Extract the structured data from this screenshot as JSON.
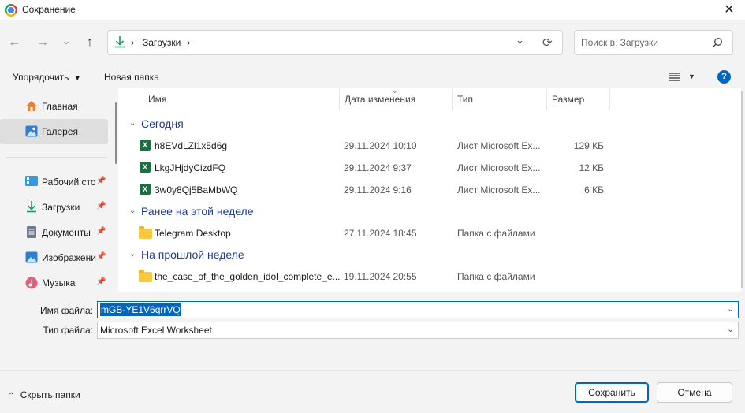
{
  "window": {
    "title": "Сохранение",
    "close_glyph": "✕"
  },
  "nav": {
    "back_glyph": "←",
    "forward_glyph": "→",
    "recent_glyph": "⌄",
    "up_glyph": "↑",
    "path_separator": "›",
    "path": "Загрузки",
    "path_trailing_sep": "›",
    "dropdown_glyph": "⌄",
    "refresh_glyph": "⟳",
    "search_placeholder": "Поиск в: Загрузки",
    "search_glyph": "⌕"
  },
  "toolbar": {
    "organize_label": "Упорядочить",
    "new_folder_label": "Новая папка",
    "help_glyph": "?"
  },
  "sidebar": {
    "items": [
      {
        "label": "Главная",
        "pinned": false,
        "icon": "home-icon"
      },
      {
        "label": "Галерея",
        "pinned": false,
        "icon": "gallery-icon",
        "selected": true
      },
      {
        "label": "Рабочий сто",
        "pinned": true,
        "icon": "desktop-icon"
      },
      {
        "label": "Загрузки",
        "pinned": true,
        "icon": "downloads-icon"
      },
      {
        "label": "Документы",
        "pinned": true,
        "icon": "documents-icon"
      },
      {
        "label": "Изображени",
        "pinned": true,
        "icon": "pictures-icon"
      },
      {
        "label": "Музыка",
        "pinned": true,
        "icon": "music-icon"
      }
    ],
    "pin_glyph": "📌"
  },
  "columns": {
    "name": "Имя",
    "date": "Дата изменения",
    "type": "Тип",
    "size": "Размер"
  },
  "groups": [
    {
      "label": "Сегодня",
      "rows": [
        {
          "name": "h8EVdLZl1x5d6g",
          "date": "29.11.2024 10:10",
          "type": "Лист Microsoft Ex...",
          "size": "129 КБ",
          "kind": "excel"
        },
        {
          "name": "LkgJHjdyCizdFQ",
          "date": "29.11.2024 9:37",
          "type": "Лист Microsoft Ex...",
          "size": "12 КБ",
          "kind": "excel"
        },
        {
          "name": "3w0y8Qj5BaMbWQ",
          "date": "29.11.2024 9:16",
          "type": "Лист Microsoft Ex...",
          "size": "6 КБ",
          "kind": "excel"
        }
      ]
    },
    {
      "label": "Ранее на этой неделе",
      "rows": [
        {
          "name": "Telegram Desktop",
          "date": "27.11.2024 18:45",
          "type": "Папка с файлами",
          "size": "",
          "kind": "folder"
        }
      ]
    },
    {
      "label": "На прошлой неделе",
      "rows": [
        {
          "name": "the_case_of_the_golden_idol_complete_e...",
          "date": "19.11.2024 20:55",
          "type": "Папка с файлами",
          "size": "",
          "kind": "folder"
        }
      ]
    }
  ],
  "fields": {
    "filename_label": "Имя файла:",
    "filename_value": "mGB-YE1V6qrrVQ",
    "filetype_label": "Тип файла:",
    "filetype_value": "Microsoft Excel Worksheet"
  },
  "footer": {
    "hide_folders_label": "Скрыть папки",
    "save_label": "Сохранить",
    "cancel_label": "Отмена"
  },
  "excel_glyph": "X"
}
